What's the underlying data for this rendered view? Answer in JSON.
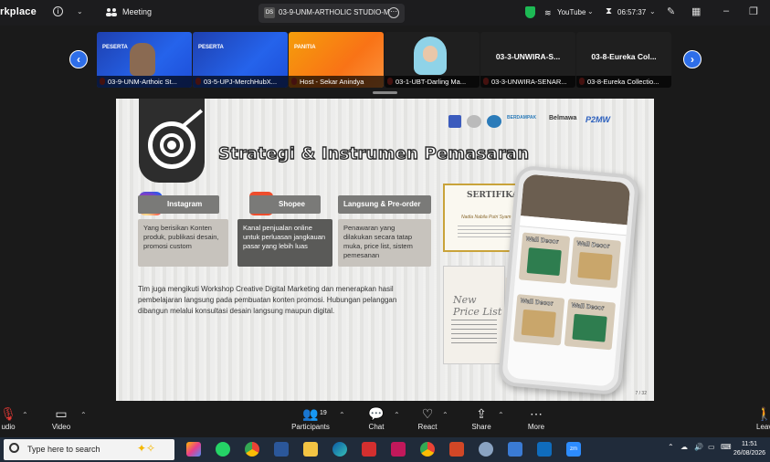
{
  "topbar": {
    "app_title": "rkplace",
    "meeting_label": "Meeting",
    "tab_badge": "DS",
    "tab_title": "03-9-UNM-ARTHOLIC STUDIO-M",
    "youtube_label": "YouTube",
    "clock": "06:57:37"
  },
  "thumbnails": [
    {
      "caption": "03-9-UNM-Arthoic St...",
      "tag": "PESERTA"
    },
    {
      "caption": "03-5-UPJ-MerchHubX...",
      "tag": "PESERTA"
    },
    {
      "caption": "Host - Sekar Anindya",
      "tag": "PANITIA"
    },
    {
      "caption": "03-1-UBT-Darling Ma...",
      "tag": ""
    },
    {
      "caption": "03-3-UNWIRA-SENAR...",
      "big_name": "03-3-UNWIRA-S..."
    },
    {
      "caption": "03-8-Eureka Collectio...",
      "big_name": "03-8-Eureka Col..."
    }
  ],
  "slide": {
    "title": "Strategi & Instrumen Pemasaran",
    "logos": {
      "l4": "BERDAMPAK",
      "l5": "Belmawa",
      "l6": "P2MW"
    },
    "cards": [
      {
        "head": "Instagram",
        "body": "Yang berisikan Konten produk, publikasi desain, promosi custom"
      },
      {
        "head": "Shopee",
        "body": "Kanal penjualan online untuk perluasan jangkauan pasar yang lebih luas"
      },
      {
        "head": "Langsung & Pre-order",
        "body": "Penawaran yang dilakukan secara tatap muka, price list, sistem pemesanan"
      }
    ],
    "paragraph": "Tim juga mengikuti Workshop Creative Digital Marketing dan menerapkan hasil pembelajaran langsung pada pembuatan konten promosi. Hubungan pelanggan dibangun melalui konsultasi desain langsung maupun digital.",
    "certificate_title": "SERTIFIKAT",
    "certificate_name": "Nadia Nabila Putri Syam",
    "pricelist_title": "New Price List",
    "product_label": "Wall Decor",
    "page_number": "7 / 32"
  },
  "toolbar": {
    "audio": "udio",
    "video": "Video",
    "participants": "Participants",
    "participants_count": "19",
    "chat": "Chat",
    "react": "React",
    "share": "Share",
    "more": "More",
    "leave": "Leav"
  },
  "taskbar": {
    "search_placeholder": "Type here to search",
    "time": "11:51",
    "date": "26/08/2026"
  },
  "colors": {
    "accent_blue": "#2e6ee8",
    "secure_green": "#1db954",
    "mic_red": "#e53935"
  }
}
